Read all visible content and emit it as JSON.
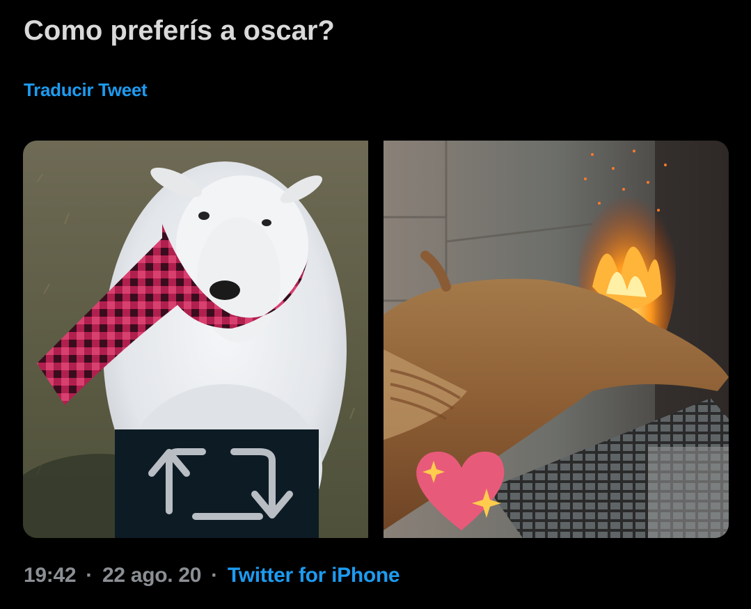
{
  "tweet": {
    "text": "Como preferís a oscar?",
    "translate_label": "Traducir Tweet"
  },
  "media": {
    "left": {
      "icon": "retweet-icon",
      "subject": "sheep-with-scarf-photo"
    },
    "right": {
      "icon": "sparkling-heart-icon",
      "subject": "roasting-lamb-photo"
    }
  },
  "meta": {
    "time": "19:42",
    "separator": "·",
    "date": "22 ago. 20",
    "source": "Twitter for iPhone"
  },
  "colors": {
    "background": "#000000",
    "text": "#d9d9d9",
    "link": "#1d9bf0",
    "muted": "#8b8f94"
  }
}
